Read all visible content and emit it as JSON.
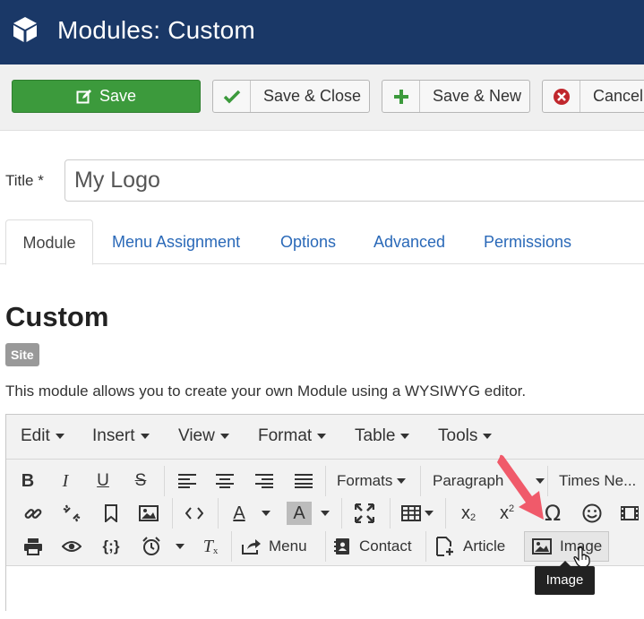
{
  "header": {
    "title": "Modules: Custom",
    "icon": "cube-icon"
  },
  "toolbar": {
    "save": "Save",
    "save_close": "Save & Close",
    "save_new": "Save & New",
    "cancel": "Cancel"
  },
  "form": {
    "title_label": "Title *",
    "title_value": "My Logo"
  },
  "tabs": [
    {
      "label": "Module",
      "active": true
    },
    {
      "label": "Menu Assignment"
    },
    {
      "label": "Options"
    },
    {
      "label": "Advanced"
    },
    {
      "label": "Permissions"
    }
  ],
  "module": {
    "heading": "Custom",
    "badge": "Site",
    "description": "This module allows you to create your own Module using a WYSIWYG editor."
  },
  "editor": {
    "menus": [
      "Edit",
      "Insert",
      "View",
      "Format",
      "Table",
      "Tools"
    ],
    "formats_label": "Formats",
    "paragraph_label": "Paragraph",
    "font_label": "Times Ne...",
    "menu_button": "Menu",
    "contact_button": "Contact",
    "article_button": "Article",
    "image_button": "Image",
    "tooltip": "Image"
  },
  "colors": {
    "header_bg": "#1a3867",
    "save_green": "#3c9a3c",
    "tab_link": "#2a69b8",
    "arrow_red": "#f05a6a"
  }
}
